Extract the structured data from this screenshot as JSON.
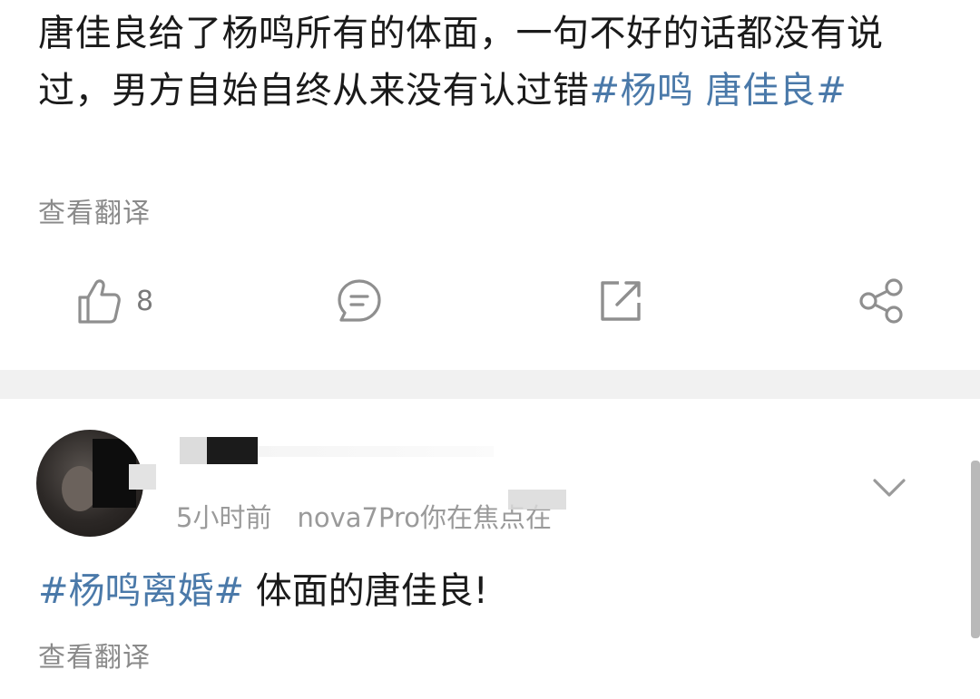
{
  "post1": {
    "text_before_tag": "唐佳良给了杨鸣所有的体面，一句不好的话都没有说过，男方自始自终从来没有认过错",
    "hashtag": "#杨鸣 唐佳良#",
    "translate_label": "查看翻译",
    "actions": {
      "like_count": "8",
      "icons": [
        "thumbs-up-icon",
        "comment-icon",
        "forward-icon",
        "share-icon"
      ]
    }
  },
  "post2": {
    "time": "5小时前",
    "device": "nova7Pro你在焦点在",
    "hashtag": "#杨鸣离婚#",
    "text": " 体面的唐佳良!",
    "translate_label": "查看翻译"
  },
  "colors": {
    "hashtag": "#4a79a9",
    "body_text": "#1a1a1a",
    "secondary_text": "#8a8a8a",
    "divider": "#f1f1f1"
  }
}
